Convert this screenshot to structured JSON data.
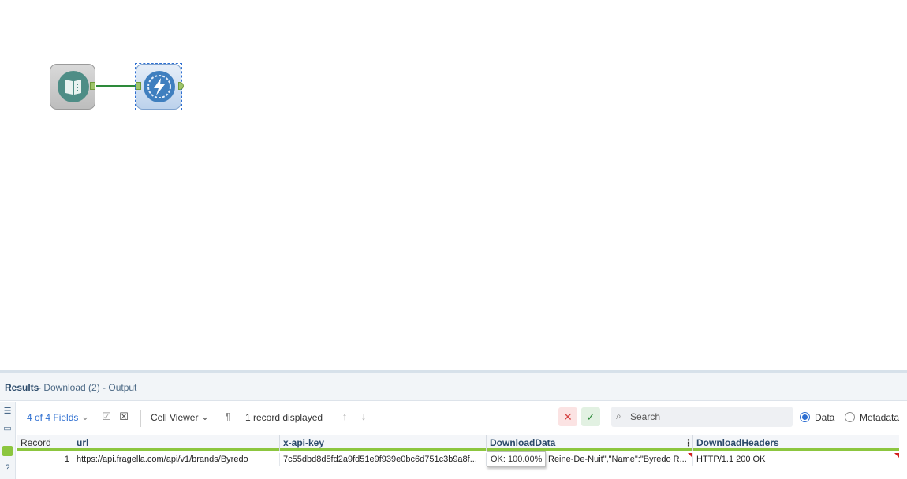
{
  "canvas": {
    "tools": [
      {
        "name": "Text Input"
      },
      {
        "name": "Download"
      }
    ]
  },
  "results": {
    "title": "Results",
    "subtitle": "- Download (2) - Output"
  },
  "toolbar": {
    "fields_label": "4 of 4 Fields",
    "cell_viewer_label": "Cell Viewer",
    "records_label": "1 record displayed",
    "search_placeholder": "Search",
    "data_label": "Data",
    "metadata_label": "Metadata",
    "selected_view": "Data"
  },
  "grid": {
    "columns": [
      "Record",
      "url",
      "x-api-key",
      "DownloadData",
      "DownloadHeaders"
    ],
    "rows": [
      {
        "record": "1",
        "url": "https://api.fragella.com/api/v1/brands/Byredo",
        "x_api_key": "7c55dbd8d5fd2a9fd51e9f939e0bc6d751c3b9a8f...",
        "download_data": "Reine-De-Nuit\",\"Name\":\"Byredo  R...",
        "download_headers": "HTTP/1.1 200 OK"
      }
    ],
    "tooltip": "OK: 100.00%"
  },
  "colors": {
    "accent": "#2e6fd1",
    "connector": "#2d8a3a",
    "header_underline": "#8cc63f",
    "flag": "#d21f1f"
  }
}
